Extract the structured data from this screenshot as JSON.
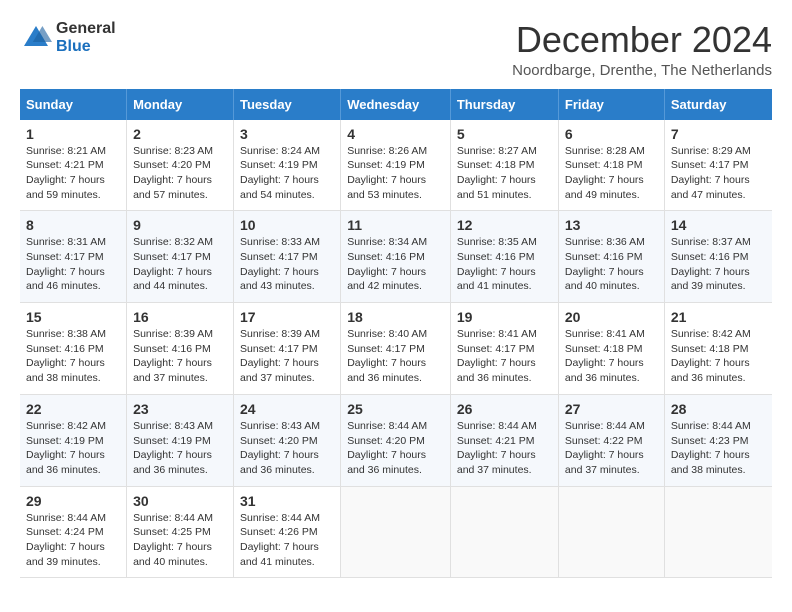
{
  "logo": {
    "general": "General",
    "blue": "Blue"
  },
  "header": {
    "month_year": "December 2024",
    "location": "Noordbarge, Drenthe, The Netherlands"
  },
  "days_of_week": [
    "Sunday",
    "Monday",
    "Tuesday",
    "Wednesday",
    "Thursday",
    "Friday",
    "Saturday"
  ],
  "weeks": [
    [
      {
        "day": 1,
        "sunrise": "8:21 AM",
        "sunset": "4:21 PM",
        "daylight": "7 hours and 59 minutes."
      },
      {
        "day": 2,
        "sunrise": "8:23 AM",
        "sunset": "4:20 PM",
        "daylight": "7 hours and 57 minutes."
      },
      {
        "day": 3,
        "sunrise": "8:24 AM",
        "sunset": "4:19 PM",
        "daylight": "7 hours and 54 minutes."
      },
      {
        "day": 4,
        "sunrise": "8:26 AM",
        "sunset": "4:19 PM",
        "daylight": "7 hours and 53 minutes."
      },
      {
        "day": 5,
        "sunrise": "8:27 AM",
        "sunset": "4:18 PM",
        "daylight": "7 hours and 51 minutes."
      },
      {
        "day": 6,
        "sunrise": "8:28 AM",
        "sunset": "4:18 PM",
        "daylight": "7 hours and 49 minutes."
      },
      {
        "day": 7,
        "sunrise": "8:29 AM",
        "sunset": "4:17 PM",
        "daylight": "7 hours and 47 minutes."
      }
    ],
    [
      {
        "day": 8,
        "sunrise": "8:31 AM",
        "sunset": "4:17 PM",
        "daylight": "7 hours and 46 minutes."
      },
      {
        "day": 9,
        "sunrise": "8:32 AM",
        "sunset": "4:17 PM",
        "daylight": "7 hours and 44 minutes."
      },
      {
        "day": 10,
        "sunrise": "8:33 AM",
        "sunset": "4:17 PM",
        "daylight": "7 hours and 43 minutes."
      },
      {
        "day": 11,
        "sunrise": "8:34 AM",
        "sunset": "4:16 PM",
        "daylight": "7 hours and 42 minutes."
      },
      {
        "day": 12,
        "sunrise": "8:35 AM",
        "sunset": "4:16 PM",
        "daylight": "7 hours and 41 minutes."
      },
      {
        "day": 13,
        "sunrise": "8:36 AM",
        "sunset": "4:16 PM",
        "daylight": "7 hours and 40 minutes."
      },
      {
        "day": 14,
        "sunrise": "8:37 AM",
        "sunset": "4:16 PM",
        "daylight": "7 hours and 39 minutes."
      }
    ],
    [
      {
        "day": 15,
        "sunrise": "8:38 AM",
        "sunset": "4:16 PM",
        "daylight": "7 hours and 38 minutes."
      },
      {
        "day": 16,
        "sunrise": "8:39 AM",
        "sunset": "4:16 PM",
        "daylight": "7 hours and 37 minutes."
      },
      {
        "day": 17,
        "sunrise": "8:39 AM",
        "sunset": "4:17 PM",
        "daylight": "7 hours and 37 minutes."
      },
      {
        "day": 18,
        "sunrise": "8:40 AM",
        "sunset": "4:17 PM",
        "daylight": "7 hours and 36 minutes."
      },
      {
        "day": 19,
        "sunrise": "8:41 AM",
        "sunset": "4:17 PM",
        "daylight": "7 hours and 36 minutes."
      },
      {
        "day": 20,
        "sunrise": "8:41 AM",
        "sunset": "4:18 PM",
        "daylight": "7 hours and 36 minutes."
      },
      {
        "day": 21,
        "sunrise": "8:42 AM",
        "sunset": "4:18 PM",
        "daylight": "7 hours and 36 minutes."
      }
    ],
    [
      {
        "day": 22,
        "sunrise": "8:42 AM",
        "sunset": "4:19 PM",
        "daylight": "7 hours and 36 minutes."
      },
      {
        "day": 23,
        "sunrise": "8:43 AM",
        "sunset": "4:19 PM",
        "daylight": "7 hours and 36 minutes."
      },
      {
        "day": 24,
        "sunrise": "8:43 AM",
        "sunset": "4:20 PM",
        "daylight": "7 hours and 36 minutes."
      },
      {
        "day": 25,
        "sunrise": "8:44 AM",
        "sunset": "4:20 PM",
        "daylight": "7 hours and 36 minutes."
      },
      {
        "day": 26,
        "sunrise": "8:44 AM",
        "sunset": "4:21 PM",
        "daylight": "7 hours and 37 minutes."
      },
      {
        "day": 27,
        "sunrise": "8:44 AM",
        "sunset": "4:22 PM",
        "daylight": "7 hours and 37 minutes."
      },
      {
        "day": 28,
        "sunrise": "8:44 AM",
        "sunset": "4:23 PM",
        "daylight": "7 hours and 38 minutes."
      }
    ],
    [
      {
        "day": 29,
        "sunrise": "8:44 AM",
        "sunset": "4:24 PM",
        "daylight": "7 hours and 39 minutes."
      },
      {
        "day": 30,
        "sunrise": "8:44 AM",
        "sunset": "4:25 PM",
        "daylight": "7 hours and 40 minutes."
      },
      {
        "day": 31,
        "sunrise": "8:44 AM",
        "sunset": "4:26 PM",
        "daylight": "7 hours and 41 minutes."
      },
      null,
      null,
      null,
      null
    ]
  ],
  "cell_labels": {
    "sunrise": "Sunrise:",
    "sunset": "Sunset:",
    "daylight": "Daylight:"
  }
}
